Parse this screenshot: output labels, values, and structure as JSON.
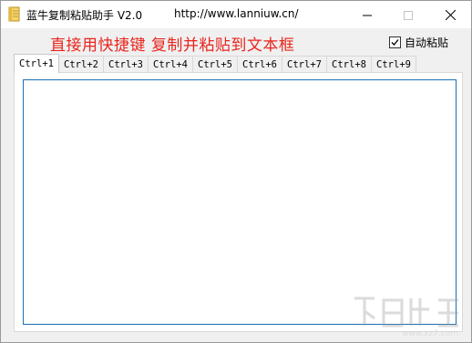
{
  "titlebar": {
    "title": "蓝牛复制粘贴助手 V2.0",
    "url": "http://www.lanniuw.cn/"
  },
  "header": {
    "headline": "直接用快捷键  复制并粘贴到文本框",
    "autopaste_label": "自动粘贴",
    "autopaste_checked": true
  },
  "tabs": [
    {
      "label": "Ctrl+1",
      "active": true
    },
    {
      "label": "Ctrl+2",
      "active": false
    },
    {
      "label": "Ctrl+3",
      "active": false
    },
    {
      "label": "Ctrl+4",
      "active": false
    },
    {
      "label": "Ctrl+5",
      "active": false
    },
    {
      "label": "Ctrl+6",
      "active": false
    },
    {
      "label": "Ctrl+7",
      "active": false
    },
    {
      "label": "Ctrl+8",
      "active": false
    },
    {
      "label": "Ctrl+9",
      "active": false
    }
  ],
  "editor": {
    "value": ""
  },
  "watermark": {
    "text": "www.xz7.com"
  },
  "colors": {
    "headline": "#e8251d",
    "textarea_border": "#1e6fb3"
  },
  "icons": {
    "app": "notebook-icon",
    "minimize": "minimize-icon",
    "maximize": "maximize-icon",
    "close": "close-icon",
    "checkbox": "checkmark-icon"
  }
}
